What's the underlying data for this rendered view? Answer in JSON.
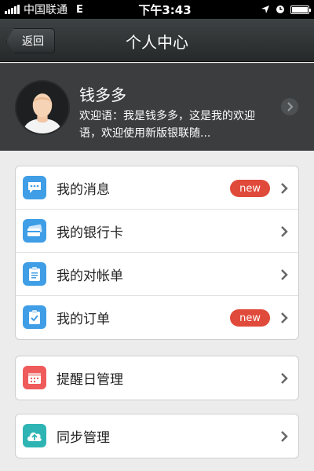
{
  "status": {
    "carrier": "中国联通",
    "network": "E",
    "time": "下午3:43"
  },
  "nav": {
    "back_label": "返回",
    "title": "个人中心"
  },
  "profile": {
    "name": "钱多多",
    "greeting": "欢迎语：我是钱多多，这是我的欢迎语，欢迎使用新版银联随..."
  },
  "menu_group_1": [
    {
      "label": "我的消息",
      "badge": "new",
      "icon": "message-icon",
      "color": "#3f9ee6"
    },
    {
      "label": "我的银行卡",
      "badge": "",
      "icon": "bank-card-icon",
      "color": "#3f9ee6"
    },
    {
      "label": "我的对帐单",
      "badge": "",
      "icon": "statement-icon",
      "color": "#3f9ee6"
    },
    {
      "label": "我的订单",
      "badge": "new",
      "icon": "order-icon",
      "color": "#3f9ee6"
    }
  ],
  "menu_group_2": [
    {
      "label": "提醒日管理",
      "icon": "calendar-icon",
      "color": "#ef5b5b"
    }
  ],
  "menu_group_3": [
    {
      "label": "同步管理",
      "icon": "cloud-upload-icon",
      "color": "#2fb4b4"
    }
  ]
}
